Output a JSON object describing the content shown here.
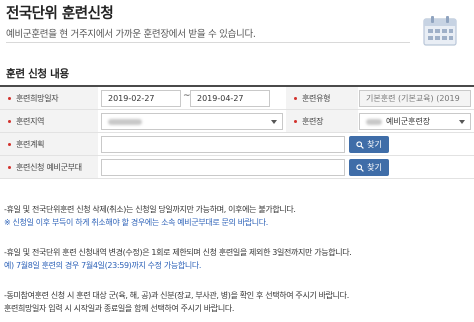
{
  "header": {
    "title": "전국단위 훈련신청",
    "description": "예비군훈련을 현 거주지에서 가까운 훈련장에서 받을 수 있습니다."
  },
  "section": {
    "title": "훈련 신청 내용"
  },
  "form": {
    "desired_date": {
      "label": "훈련희망일자",
      "start": "2019-02-27",
      "separator": "~",
      "end": "2019-04-27"
    },
    "training_type": {
      "label": "훈련유형",
      "value": "기본훈련 (기본교육) (2019"
    },
    "training_region": {
      "label": "훈련지역",
      "value": ""
    },
    "training_site": {
      "label": "훈련장",
      "value": "예비군훈련장"
    },
    "training_plan": {
      "label": "훈련계획",
      "value": ""
    },
    "applying_unit": {
      "label": "훈련신청 예비군부대",
      "value": ""
    },
    "search_label": "찾기"
  },
  "notices": [
    {
      "text": "-휴일 및 전국단위훈련 신청 삭제(취소)는 신청일 당일까지만 가능하며, 이후에는 불가합니다.",
      "color": "black"
    },
    {
      "text": "※ 신청일 이후 부득이 하게 취소해야 할 경우에는 소속 예비군부대로 문의 바랍니다.",
      "color": "blue"
    },
    {
      "text": "-휴일 및 전국단위 훈련 신청내역 변경(수정)은 1회로 제한되며 신청 훈련일을 제외한 3일전까지만 가능합니다.",
      "color": "black"
    },
    {
      "text": "예) 7월8일 훈련의 경우 7월4일(23:59)까지 수정 가능합니다.",
      "color": "blue"
    },
    {
      "text": "-동미참여훈련 신청 시 훈련 대상 군(육, 해, 공)과 신분(장교, 부사관, 병)을 확인 후 선택하여 주시기 바랍니다.",
      "color": "black"
    },
    {
      "text": "훈련희망일자 입력 시 시작일과 종료일을 함께 선택하여 주시기 바랍니다.",
      "color": "black"
    }
  ],
  "colors": {
    "accent": "#3f6da8",
    "required_bullet": "#d2322d",
    "notice_blue": "#2d62b8"
  }
}
